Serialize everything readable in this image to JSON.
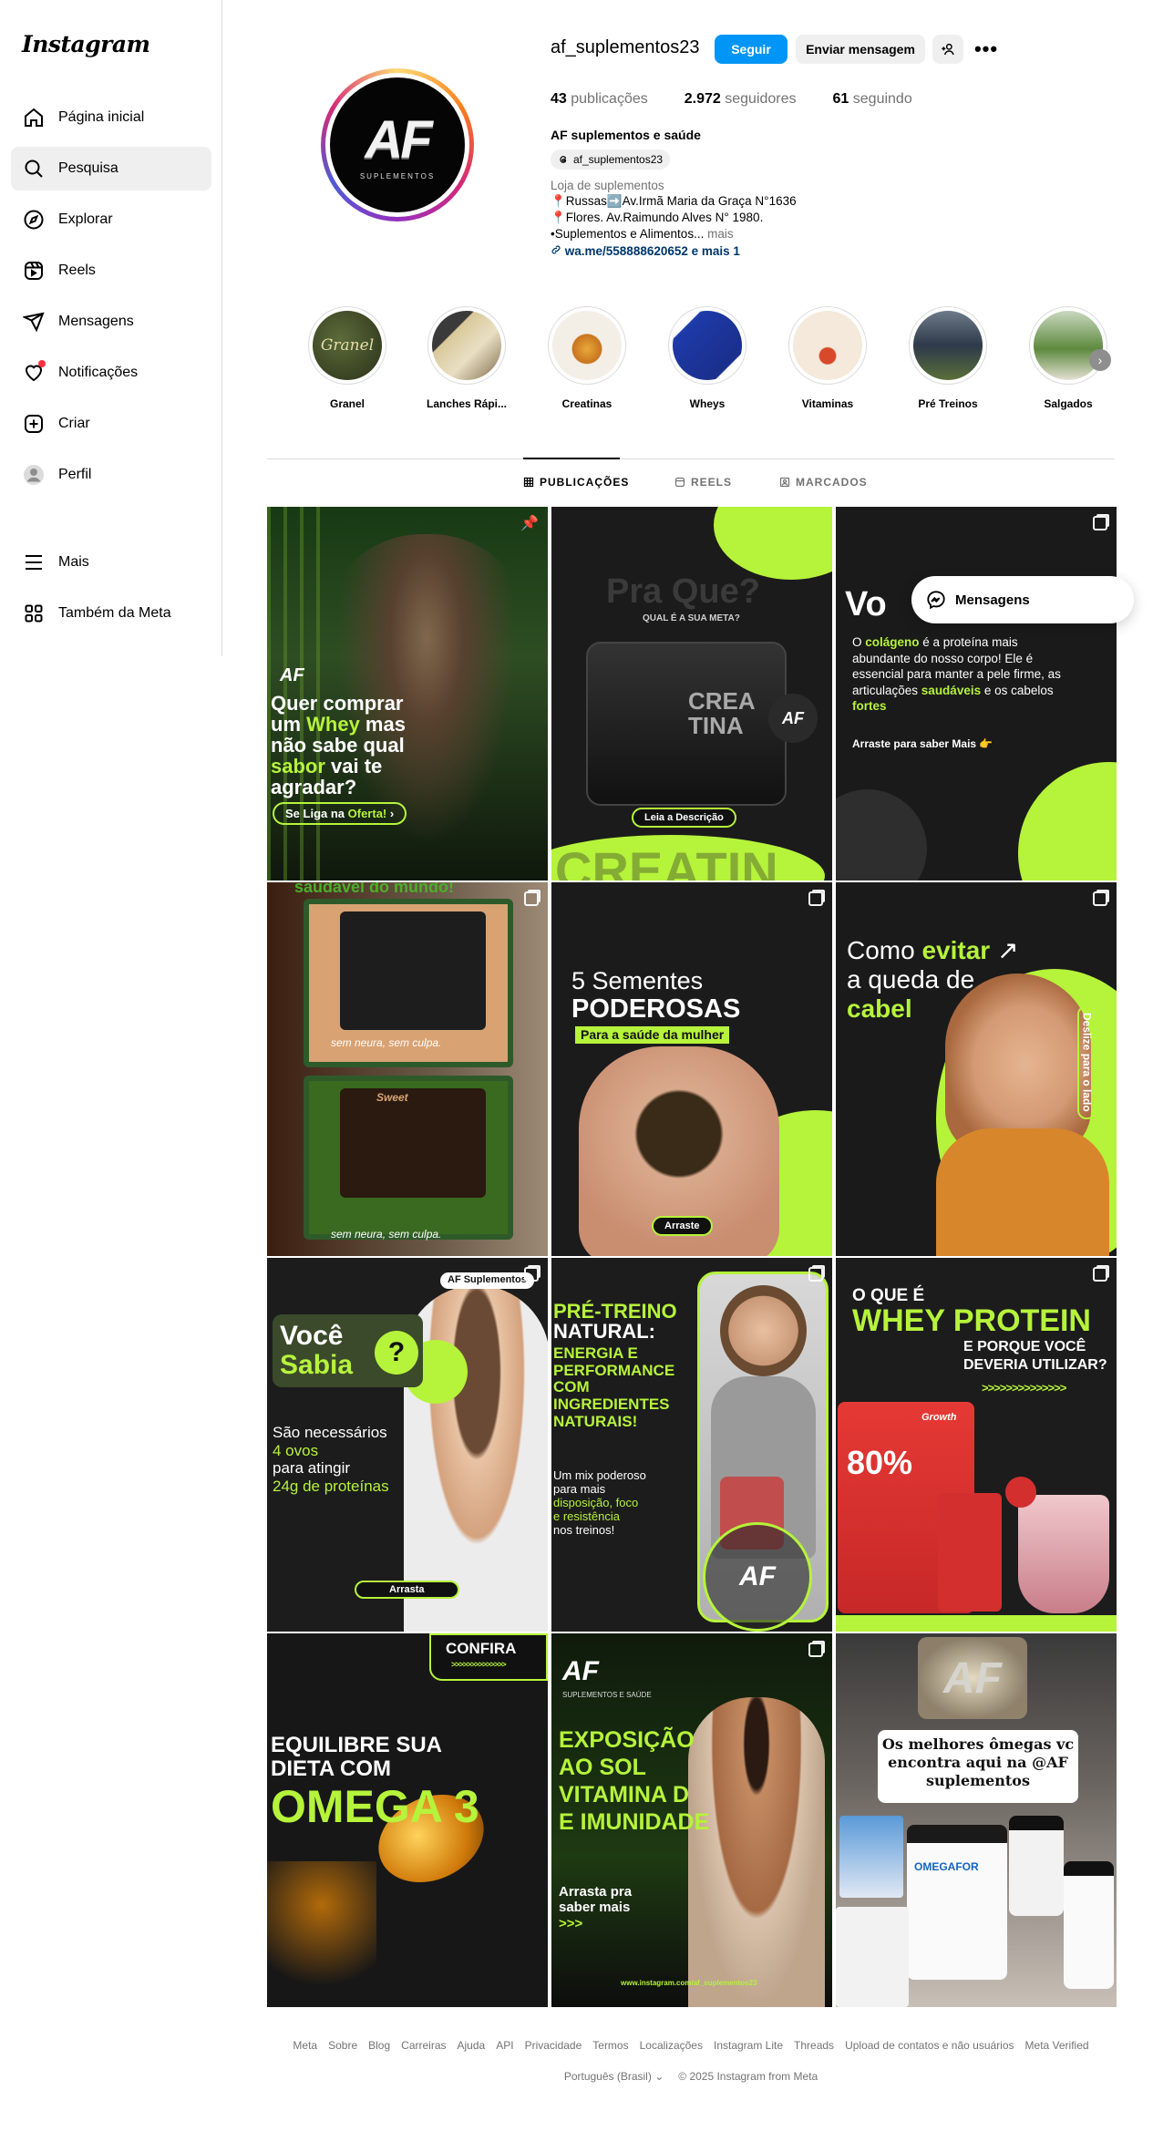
{
  "brand": {
    "logo": "Instagram",
    "accent": "#0095f6",
    "lime": "#b6f33b"
  },
  "sidebar": {
    "items": [
      {
        "label": "Página inicial",
        "icon": "home-icon"
      },
      {
        "label": "Pesquisa",
        "icon": "search-icon"
      },
      {
        "label": "Explorar",
        "icon": "compass-icon"
      },
      {
        "label": "Reels",
        "icon": "reels-icon"
      },
      {
        "label": "Mensagens",
        "icon": "send-icon"
      },
      {
        "label": "Notificações",
        "icon": "heart-icon"
      },
      {
        "label": "Criar",
        "icon": "plus-square-icon"
      },
      {
        "label": "Perfil",
        "icon": "avatar-icon"
      },
      {
        "label": "Mais",
        "icon": "menu-icon"
      },
      {
        "label": "Também da Meta",
        "icon": "apps-icon"
      }
    ]
  },
  "profile": {
    "username": "af_suplementos23",
    "follow_label": "Seguir",
    "message_label": "Enviar mensagem",
    "add_icon": "+👤",
    "more": "•••",
    "avatar_logo": "AF",
    "avatar_sub": "SUPLEMENTOS",
    "stats": {
      "posts_num": "43",
      "posts_label": "publicações",
      "followers_num": "2.972",
      "followers_label": "seguidores",
      "following_num": "61",
      "following_label": "seguindo"
    },
    "full_name": "AF suplementos e saúde",
    "threads_handle": "af_suplementos23",
    "bio": {
      "category": "Loja de suplementos",
      "line1": "📍Russas➡️Av.Irmã Maria da Graça N°1636",
      "line2": "📍Flores. Av.Raimundo Alves N° 1980.",
      "line3": "•Suplementos e Alimentos...",
      "more": "mais",
      "link": "wa.me/558888620652 e mais 1"
    }
  },
  "highlights": [
    {
      "label": "Granel"
    },
    {
      "label": "Lanches Rápi..."
    },
    {
      "label": "Creatinas"
    },
    {
      "label": "Wheys"
    },
    {
      "label": "Vitaminas"
    },
    {
      "label": "Pré Treinos"
    },
    {
      "label": "Salgados"
    }
  ],
  "tabs": {
    "posts": "PUBLICAÇÕES",
    "reels": "REELS",
    "tagged": "MARCADOS"
  },
  "posts": {
    "p1": {
      "logo": "AF",
      "l1": "Quer comprar",
      "l2a": "um ",
      "l2b": "Whey",
      "l2c": " mas",
      "l3": "não sabe qual",
      "l4a": "sabor",
      "l4b": " vai te",
      "l5": "agradar?",
      "cta_a": "Se Liga na ",
      "cta_b": "Oferta!"
    },
    "p2": {
      "title": "Pra Que?",
      "q": "QUAL É A SUA META?",
      "product": "CREA TINA",
      "cta": "Leia a Descrição",
      "bg_word": "CREATIN"
    },
    "p3": {
      "title": "Vo",
      "body_a": "O ",
      "body_b": "colágeno",
      "body_c": " é a proteína mais abundante do nosso corpo! Ele é essencial para manter a pele firme, as articulações ",
      "body_d": "saudáveis",
      "body_e": " e os cabelos ",
      "body_f": "fortes",
      "cta": "Arraste para saber Mais 👉"
    },
    "p4": {
      "top": "saudável do mundo!",
      "box1": "sem neura, sem culpa.",
      "box2": "sem neura, sem culpa.",
      "brand": "Sweet"
    },
    "p5": {
      "l1": "5 Sementes",
      "l2": "PODEROSAS",
      "l3": "Para a saúde da mulher",
      "cta": "Arraste"
    },
    "p6": {
      "l1a": "Como ",
      "l1b": "evitar",
      "l2": "a queda de",
      "l3": "cabel",
      "side": "Deslize para o lado"
    },
    "p7": {
      "badge": "AF Suplementos",
      "l1": "Você",
      "l2": "Sabia",
      "b1": "São necessários",
      "b2": "4 ovos",
      "b3": "para atingir",
      "b4": "24g de proteínas",
      "cta": "Arrasta"
    },
    "p8": {
      "l1": "PRÉ-TREINO",
      "l2": "NATURAL:",
      "l3": "ENERGIA E",
      "l4": "PERFORMANCE",
      "l5": "COM",
      "l6": "INGREDIENTES",
      "l7": "NATURAIS!",
      "b1": "Um mix poderoso",
      "b2": "para mais",
      "b3": "disposição, foco",
      "b4": "e resistência",
      "b5": "nos treinos!"
    },
    "p9": {
      "l1": "O QUE É",
      "l2": "WHEY PROTEIN",
      "l3": "E PORQUE VOCÊ",
      "l4": "DEVERIA UTILIZAR?",
      "arrows": ">>>>>>>>>>>>>>",
      "pack_big": "80%",
      "pack_brand": "Growth"
    },
    "p10": {
      "badge": "CONFIRA",
      "badge_sub": ">>>>>>>>>>>>>>",
      "l1": "EQUILIBRE SUA",
      "l2": "DIETA COM",
      "l3": "OMEGA 3"
    },
    "p11": {
      "logo": "AF",
      "logo_sub": "SUPLEMENTOS E SAÚDE",
      "l1": "EXPOSIÇÃO",
      "l2": "AO SOL",
      "l3": "VITAMINA D",
      "l4": "E IMUNIDADE",
      "c1": "Arrasta pra",
      "c2": "saber mais",
      "c3": ">>>",
      "url": "www.instagram.com/af_suplementos23"
    },
    "p12": {
      "l1": "Os melhores ômegas vc",
      "l2": "encontra aqui na @AF",
      "l3": "suplementos",
      "jar": "OMEGAFOR"
    }
  },
  "floating": {
    "messages_label": "Mensagens"
  },
  "footer": {
    "links": [
      "Meta",
      "Sobre",
      "Blog",
      "Carreiras",
      "Ajuda",
      "API",
      "Privacidade",
      "Termos",
      "Localizações",
      "Instagram Lite",
      "Threads",
      "Upload de contatos e não usuários",
      "Meta Verified"
    ],
    "language": "Português (Brasil)",
    "copyright": "© 2025 Instagram from Meta"
  }
}
